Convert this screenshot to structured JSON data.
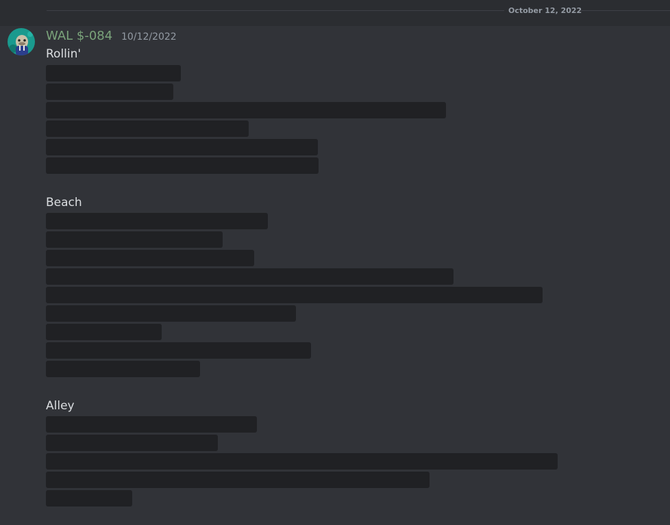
{
  "date_divider": "October 12, 2022",
  "message": {
    "author": "WAL $-084",
    "timestamp": "10/12/2022",
    "avatar_icon": "walrus-avatar-icon",
    "author_color": "#7aa37a"
  },
  "sections": [
    {
      "title": "Rollin'",
      "spoiler_count": 6
    },
    {
      "title": "Beach",
      "spoiler_count": 9
    },
    {
      "title": "Alley",
      "spoiler_count": 5
    }
  ]
}
